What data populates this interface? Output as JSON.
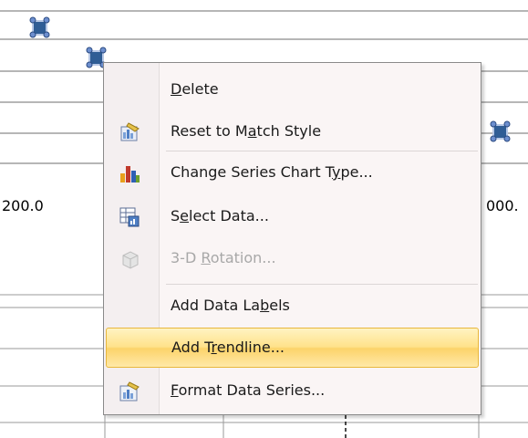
{
  "chart_background": {
    "axis_label_left": "200.0",
    "axis_label_right": "000."
  },
  "context_menu": {
    "items": [
      {
        "label": "Delete",
        "mnemonic": "D",
        "icon": "none",
        "enabled": true
      },
      {
        "label": "Reset to Match Style",
        "mnemonic": "a",
        "icon": "reset-style-icon",
        "enabled": true
      },
      {
        "label": "Change Series Chart Type...",
        "mnemonic": "Y",
        "icon": "chart-type-icon",
        "enabled": true
      },
      {
        "label": "Select Data...",
        "mnemonic": "e",
        "icon": "select-data-icon",
        "enabled": true
      },
      {
        "label": "3-D Rotation...",
        "mnemonic": "R",
        "icon": "3d-rotation-icon",
        "enabled": false
      },
      {
        "label": "Add Data Labels",
        "mnemonic": "b",
        "icon": "none",
        "enabled": true
      },
      {
        "label": "Add Trendline...",
        "mnemonic": "r",
        "icon": "none",
        "enabled": true,
        "highlighted": true
      },
      {
        "label": "Format Data Series...",
        "mnemonic": "F",
        "icon": "format-series-icon",
        "enabled": true
      }
    ]
  },
  "colors": {
    "highlight": "#ffe28a",
    "menu_background": "#faf5f5",
    "marker": "#2f5d95"
  }
}
